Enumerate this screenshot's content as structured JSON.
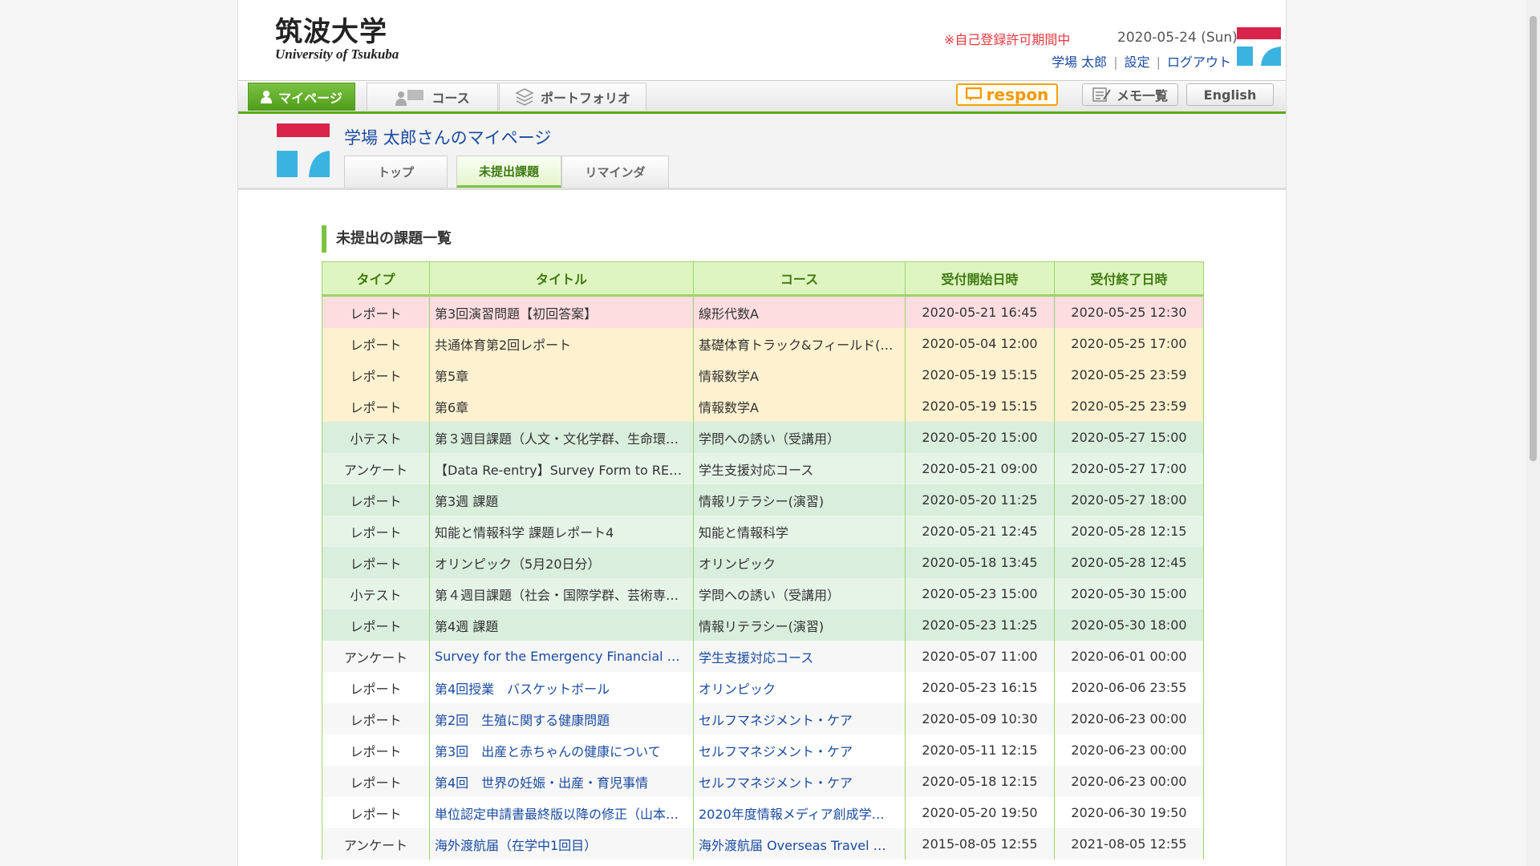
{
  "header": {
    "logo_jp": "筑波大学",
    "logo_en": "University of Tsukuba",
    "notice": "※自己登録許可期間中",
    "date": "2020-05-24 (Sun)",
    "user_name": "学場 太郎",
    "settings": "設定",
    "logout": "ログアウト"
  },
  "gnav": {
    "mypage": "マイページ",
    "course": "コース",
    "portfolio": "ポートフォリオ",
    "respon": "respon",
    "memo": "メモ一覧",
    "english": "English"
  },
  "subhead": {
    "title": "学場 太郎さんのマイページ",
    "tabs": [
      "トップ",
      "未提出課題",
      "リマインダ"
    ]
  },
  "section_title": "未提出の課題一覧",
  "table": {
    "headers": [
      "タイプ",
      "タイトル",
      "コース",
      "受付開始日時",
      "受付終了日時"
    ],
    "rows": [
      [
        "レポート",
        "第3回演習問題【初回答案】",
        "線形代数A",
        "2020-05-21 16:45",
        "2020-05-25 12:30"
      ],
      [
        "レポート",
        "共通体育第2回レポート",
        "基礎体育トラック&フィールド(…",
        "2020-05-04 12:00",
        "2020-05-25 17:00"
      ],
      [
        "レポート",
        "第5章",
        "情報数学A",
        "2020-05-19 15:15",
        "2020-05-25 23:59"
      ],
      [
        "レポート",
        "第6章",
        "情報数学A",
        "2020-05-19 15:15",
        "2020-05-25 23:59"
      ],
      [
        "小テスト",
        "第３週目課題（人文・文化学群、生命環…",
        "学問への誘い（受講用）",
        "2020-05-20 15:00",
        "2020-05-27 15:00"
      ],
      [
        "アンケート",
        "【Data Re-entry】Survey Form to RE…",
        "学生支援対応コース",
        "2020-05-21 09:00",
        "2020-05-27 17:00"
      ],
      [
        "レポート",
        "第3週 課題",
        "情報リテラシー(演習)",
        "2020-05-20 11:25",
        "2020-05-27 18:00"
      ],
      [
        "レポート",
        "知能と情報科学 課題レポート4",
        "知能と情報科学",
        "2020-05-21 12:45",
        "2020-05-28 12:15"
      ],
      [
        "レポート",
        "オリンピック（5月20日分）",
        "オリンピック",
        "2020-05-18 13:45",
        "2020-05-28 12:45"
      ],
      [
        "小テスト",
        "第４週目課題（社会・国際学群、芸術専…",
        "学問への誘い（受講用）",
        "2020-05-23 15:00",
        "2020-05-30 15:00"
      ],
      [
        "レポート",
        "第4週 課題",
        "情報リテラシー(演習)",
        "2020-05-23 11:25",
        "2020-05-30 18:00"
      ],
      [
        "アンケート",
        "Survey for the Emergency Financial …",
        "学生支援対応コース",
        "2020-05-07 11:00",
        "2020-06-01 00:00"
      ],
      [
        "レポート",
        "第4回授業　バスケットボール",
        "オリンピック",
        "2020-05-23 16:15",
        "2020-06-06 23:55"
      ],
      [
        "レポート",
        "第2回　生殖に関する健康問題",
        "セルフマネジメント・ケア",
        "2020-05-09 10:30",
        "2020-06-23 00:00"
      ],
      [
        "レポート",
        "第3回　出産と赤ちゃんの健康について",
        "セルフマネジメント・ケア",
        "2020-05-11 12:15",
        "2020-06-23 00:00"
      ],
      [
        "レポート",
        "第4回　世界の妊娠・出産・育児事情",
        "セルフマネジメント・ケア",
        "2020-05-18 12:15",
        "2020-06-23 00:00"
      ],
      [
        "レポート",
        "単位認定申請書最終版以降の修正（山本…",
        "2020年度情報メディア創成学…",
        "2020-05-20 19:50",
        "2020-06-30 19:50"
      ],
      [
        "アンケート",
        "海外渡航届（在学中1回目）",
        "海外渡航届 Overseas Travel …",
        "2015-08-05 12:55",
        "2021-08-05 12:55"
      ]
    ],
    "row_colors": [
      "pink",
      "yellow",
      "yellow",
      "yellow",
      "green",
      "green",
      "green",
      "green",
      "green",
      "green",
      "green",
      "white",
      "white",
      "white",
      "white",
      "white",
      "white",
      "white"
    ]
  },
  "colors": {
    "accent_green": "#5aaa1e",
    "brand_red": "#d9234a",
    "brand_blue": "#3bb3e0",
    "link_blue": "#1a4ba0",
    "row_pink": "#fddde0",
    "row_yellow": "#fdf1cf",
    "row_green": "#d9eedc"
  },
  "icons": [
    "user-icon",
    "people-icon",
    "stack-icon",
    "chat-icon",
    "memo-icon",
    "tsukuba-logo-mark"
  ]
}
